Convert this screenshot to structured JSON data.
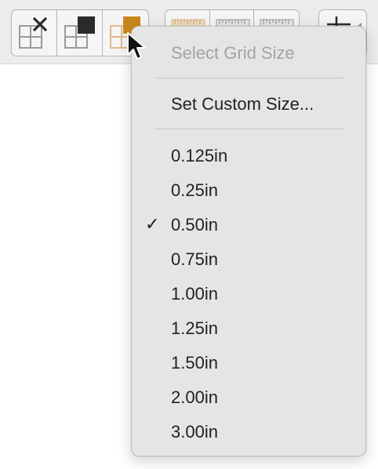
{
  "toolbar": {
    "grid_buttons": [
      {
        "icon": "grid-remove-icon"
      },
      {
        "icon": "grid-snap-icon"
      },
      {
        "icon": "grid-size-icon",
        "active": true
      }
    ],
    "ruler_buttons": [
      {
        "icon": "ruler-icon"
      },
      {
        "icon": "ruler-icon"
      },
      {
        "icon": "ruler-icon"
      }
    ],
    "align_button": {
      "icon": "align-icon"
    },
    "accent_color": "#c9861d"
  },
  "menu": {
    "header": "Select Grid Size",
    "custom_label": "Set Custom Size...",
    "check_glyph": "✓",
    "selected_index": 2,
    "sizes": [
      "0.125in",
      "0.25in",
      "0.50in",
      "0.75in",
      "1.00in",
      "1.25in",
      "1.50in",
      "2.00in",
      "3.00in"
    ]
  }
}
